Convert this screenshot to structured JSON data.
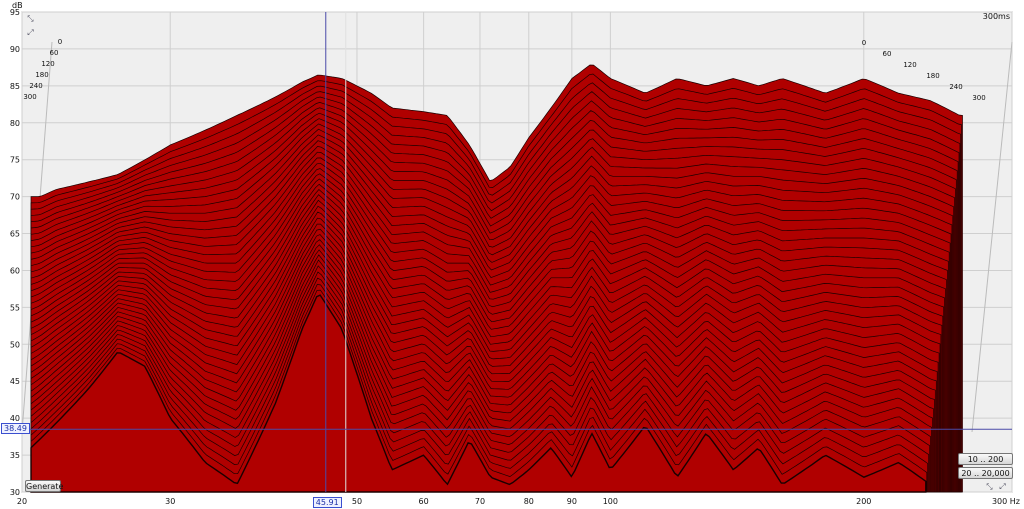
{
  "chart_data": {
    "type": "area",
    "subtype": "waterfall-3d",
    "xlabel": "Hz",
    "ylabel": "dB",
    "zlabel": "300ms",
    "xscale": "log",
    "xlim": [
      20,
      300
    ],
    "ylim": [
      30,
      95
    ],
    "x_ticks": [
      "20",
      "30",
      "50",
      "60",
      "70",
      "80",
      "90",
      "100",
      "200",
      "300 Hz"
    ],
    "y_ticks": [
      "95",
      "90",
      "85",
      "80",
      "75",
      "70",
      "65",
      "60",
      "55",
      "50",
      "45",
      "40",
      "35",
      "30"
    ],
    "z_ticks_left": [
      "0",
      "60",
      "120",
      "180",
      "240",
      "300"
    ],
    "z_ticks_right": [
      "0",
      "60",
      "120",
      "180",
      "240",
      "300"
    ],
    "grid": true,
    "fill_color": "#b00000",
    "cursor": {
      "x_readout": "45.91",
      "y_readout": "38.49"
    },
    "front_slice": {
      "time": "0",
      "x": [
        20.5,
        21,
        22,
        24,
        26,
        28,
        30,
        33,
        36,
        40,
        43,
        45,
        48,
        52,
        55,
        60,
        64,
        68,
        72,
        76,
        80,
        85,
        90,
        95,
        100,
        110,
        120,
        130,
        140,
        150,
        160,
        180,
        200,
        220,
        240,
        260
      ],
      "values": [
        70,
        70,
        71,
        72,
        73,
        75,
        77,
        79,
        81,
        83.5,
        85.5,
        86.5,
        86,
        84,
        82,
        81.5,
        81,
        77,
        72,
        74,
        78,
        82,
        86,
        88,
        86,
        84,
        86,
        85,
        86,
        85,
        86,
        84,
        86,
        84,
        83,
        81
      ]
    },
    "back_slice": {
      "time": "300",
      "x": [
        20.5,
        24,
        26,
        28,
        30,
        33,
        36,
        40,
        43,
        45,
        48,
        52,
        55,
        60,
        64,
        68,
        72,
        76,
        80,
        85,
        90,
        95,
        100,
        110,
        120,
        130,
        140,
        150,
        160,
        180,
        200,
        220,
        240,
        260
      ],
      "values": [
        36,
        44,
        49,
        47,
        40,
        34,
        31,
        42,
        52,
        57,
        52,
        40,
        33,
        35,
        31,
        37,
        32,
        31,
        33,
        36,
        32,
        38,
        33,
        39,
        32,
        38,
        33,
        36,
        31,
        35,
        32,
        34,
        31,
        30
      ]
    }
  },
  "controls": {
    "generate_label": "Generate",
    "range_low_label": "10 .. 200",
    "range_full_label": "20 .. 20,000"
  }
}
